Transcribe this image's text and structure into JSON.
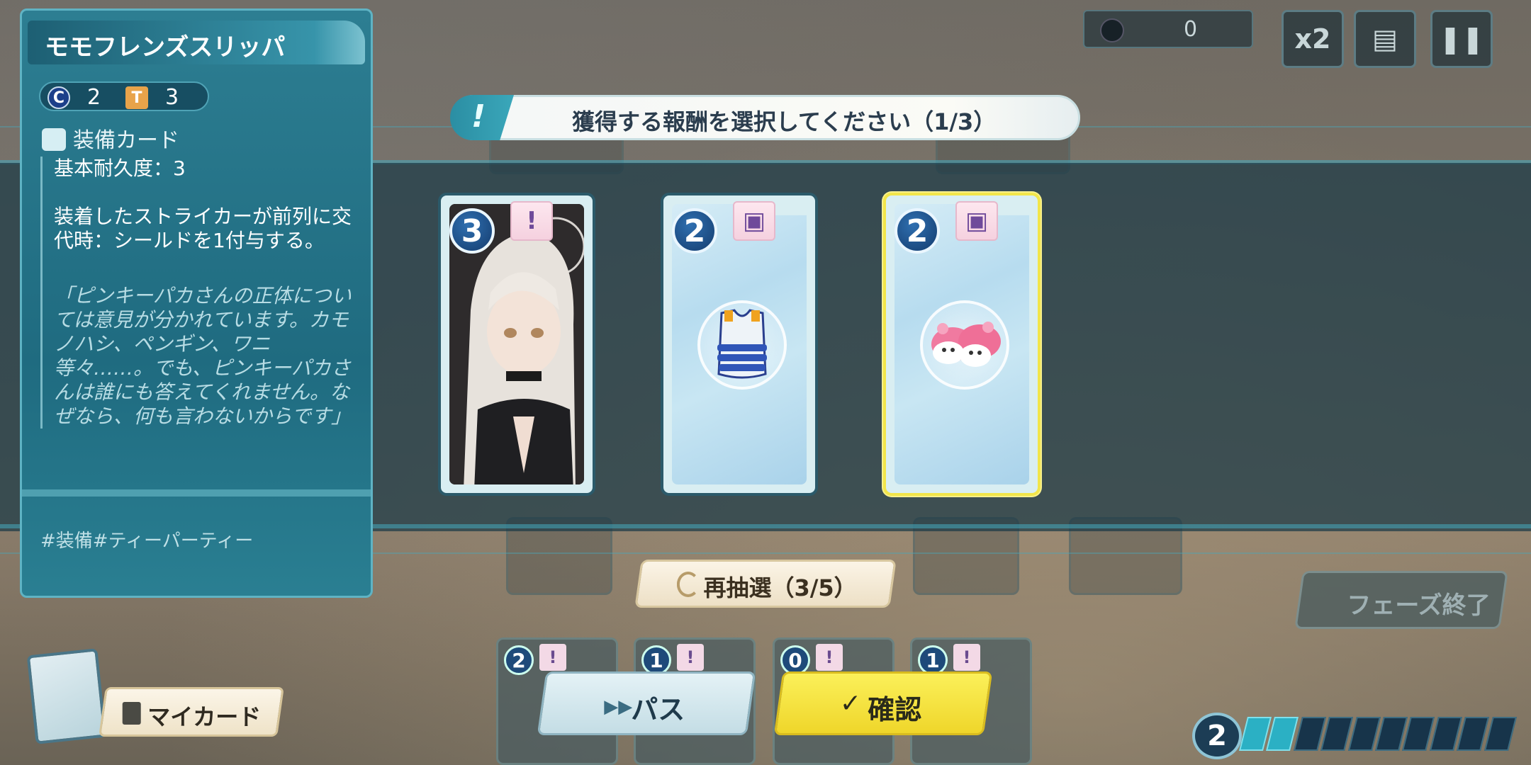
{
  "hud": {
    "score": "0",
    "speed_label": "x2"
  },
  "banner": {
    "text": "獲得する報酬を選択してください（1/3）"
  },
  "reward_cards": [
    {
      "cost": "3",
      "type_icon": "exclamation-icon",
      "art": "character-portrait",
      "selected": false
    },
    {
      "cost": "2",
      "type_icon": "equipment-box-icon",
      "art": "life-vest-icon",
      "selected": false
    },
    {
      "cost": "2",
      "type_icon": "equipment-box-icon",
      "art": "pink-slippers-icon",
      "selected": true
    }
  ],
  "info_panel": {
    "title": "モモフレンズスリッパ",
    "cost_c": "2",
    "cost_hammer": "3",
    "card_type": "装備カード",
    "durability": "基本耐久度：3",
    "effect": "装着したストライカーが前列に交代時：シールドを1付与する。",
    "flavor": "「ピンキーパカさんの正体については意見が分かれています。カモノハシ、ペンギン、ワニ等々……。でも、ピンキーパカさんは誰にも答えてくれません。なぜなら、何も言わないからです」",
    "tags": "#装備#ティーパーティー"
  },
  "buttons": {
    "reroll": "再抽選（3/5）",
    "pass": "パス",
    "confirm": "確認",
    "phase_end": "フェーズ終了",
    "my_cards": "マイカード"
  },
  "hand_costs": [
    "2",
    "1",
    "0",
    "1"
  ],
  "energy": {
    "count": "2",
    "filled_segments": 2,
    "total_segments": 10
  },
  "colors": {
    "accent": "#2b8ea3",
    "confirm": "#f2e04a",
    "panel": "#1f6b80"
  }
}
